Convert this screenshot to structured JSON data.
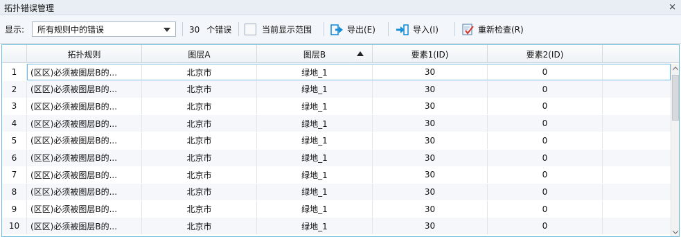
{
  "window": {
    "title": "拓扑错误管理",
    "close_glyph": "×"
  },
  "toolbar": {
    "display_label": "显示:",
    "display_select_value": "所有规则中的错误",
    "error_count": "30",
    "error_unit": "个错误",
    "current_range_label": "当前显示范围",
    "export_label": "导出(E)",
    "import_label": "导入(I)",
    "recheck_label": "重新检查(R)"
  },
  "icons": {
    "export": "export-arrow-icon",
    "import": "import-arrow-icon",
    "recheck": "check-document-icon",
    "accent": "#1a8fd6",
    "recheck_accent": "#d43a2f"
  },
  "table": {
    "columns": [
      "拓扑规则",
      "图层A",
      "图层B",
      "要素1(ID)",
      "要素2(ID)"
    ],
    "sorted_column": "图层B",
    "rows": [
      {
        "num": "1",
        "rule": "(区区)必须被图层B的...",
        "layer_a": "北京市",
        "layer_b": "绿地_1",
        "f1": "30",
        "f2": "0"
      },
      {
        "num": "2",
        "rule": "(区区)必须被图层B的...",
        "layer_a": "北京市",
        "layer_b": "绿地_1",
        "f1": "30",
        "f2": "0"
      },
      {
        "num": "3",
        "rule": "(区区)必须被图层B的...",
        "layer_a": "北京市",
        "layer_b": "绿地_1",
        "f1": "30",
        "f2": "0"
      },
      {
        "num": "4",
        "rule": "(区区)必须被图层B的...",
        "layer_a": "北京市",
        "layer_b": "绿地_1",
        "f1": "30",
        "f2": "0"
      },
      {
        "num": "5",
        "rule": "(区区)必须被图层B的...",
        "layer_a": "北京市",
        "layer_b": "绿地_1",
        "f1": "30",
        "f2": "0"
      },
      {
        "num": "6",
        "rule": "(区区)必须被图层B的...",
        "layer_a": "北京市",
        "layer_b": "绿地_1",
        "f1": "30",
        "f2": "0"
      },
      {
        "num": "7",
        "rule": "(区区)必须被图层B的...",
        "layer_a": "北京市",
        "layer_b": "绿地_1",
        "f1": "30",
        "f2": "0"
      },
      {
        "num": "8",
        "rule": "(区区)必须被图层B的...",
        "layer_a": "北京市",
        "layer_b": "绿地_1",
        "f1": "30",
        "f2": "0"
      },
      {
        "num": "9",
        "rule": "(区区)必须被图层B的...",
        "layer_a": "北京市",
        "layer_b": "绿地_1",
        "f1": "30",
        "f2": "0"
      },
      {
        "num": "10",
        "rule": "(区区)必须被图层B的...",
        "layer_a": "北京市",
        "layer_b": "绿地_1",
        "f1": "30",
        "f2": "0"
      }
    ]
  }
}
